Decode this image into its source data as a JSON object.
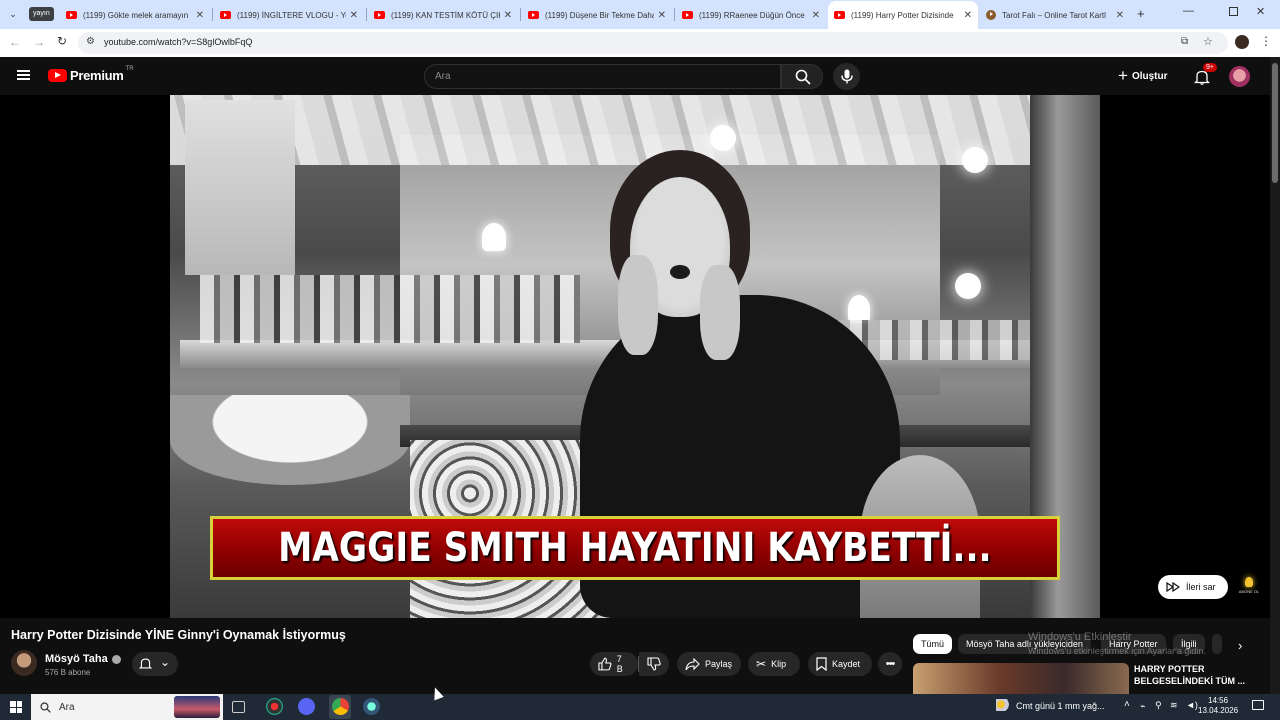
{
  "browser": {
    "profile_badge": "yayın",
    "tabs": [
      {
        "title": "(1199) Gökte melek aramayın"
      },
      {
        "title": "(1199) İNGİLTERE VLOGU - Yo"
      },
      {
        "title": "(1199) KAN TESTİM KÖTÜ ÇIK"
      },
      {
        "title": "(1199) Düşene Bir Tekme Daha"
      },
      {
        "title": "(1199) RRaenee Düğün Önce"
      },
      {
        "title": "(1199) Harry Potter Dizisinde"
      },
      {
        "title": "Tarot Falı – Online Tarot Kartl"
      }
    ],
    "active_tab_index": 5,
    "url": "youtube.com/watch?v=S8glOwlbFqQ"
  },
  "youtube": {
    "logo_text": "Premium",
    "region": "TR",
    "search_placeholder": "Ara",
    "create_label": "Oluştur",
    "notif_count": "9+"
  },
  "video": {
    "overlay_text": "MAGGIE SMITH HAYATINI KAYBETTİ...",
    "skip_label": "İleri sar",
    "subscribe_badge": "ABONE OL",
    "title": "Harry Potter Dizisinde YİNE Ginny'i Oynamak İstiyormuş",
    "channel": "Mösyö Taha",
    "subscribers": "576 B abone",
    "likes": "7 B",
    "share_label": "Paylaş",
    "clip_label": "Klip",
    "save_label": "Kaydet"
  },
  "chips": [
    "Tümü",
    "Mösyö Taha adlı yükleyiciden",
    "Harry Potter",
    "İlgili"
  ],
  "watermark": {
    "line1": "Windows'u Etkinleştir",
    "line2": "Windows'u etkinleştirmek için Ayarlar'a gidin."
  },
  "related": {
    "title": "HARRY POTTER BELGESELİNDEKİ TÜM ..."
  },
  "taskbar": {
    "search": "Ara",
    "weather": "Cmt günü 1 mm yağ...",
    "time": "14:56",
    "date": "13.04.2026"
  }
}
